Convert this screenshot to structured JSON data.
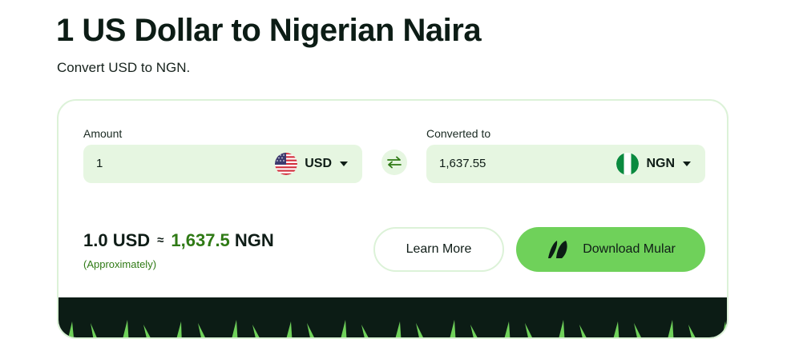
{
  "header": {
    "title": "1 US Dollar to Nigerian Naira",
    "subtitle": "Convert USD to NGN."
  },
  "converter": {
    "amount": {
      "label": "Amount",
      "value": "1",
      "currency": "USD",
      "flag_icon": "us-flag-icon"
    },
    "converted": {
      "label": "Converted to",
      "value": "1,637.55",
      "currency": "NGN",
      "flag_icon": "nigeria-flag-icon"
    },
    "swap_icon": "swap-arrows-icon"
  },
  "result": {
    "from": "1.0 USD",
    "approx_symbol": "≈",
    "to_value": "1,637.5",
    "to_currency": "NGN",
    "note": "(Approximately)"
  },
  "actions": {
    "learn_more": "Learn More",
    "download": "Download Mular",
    "download_icon": "mular-logo-icon"
  },
  "colors": {
    "accent": "#6fd15a",
    "field_bg": "#e6f6e1",
    "result_green": "#2f7a15",
    "dark": "#0c1c15"
  }
}
